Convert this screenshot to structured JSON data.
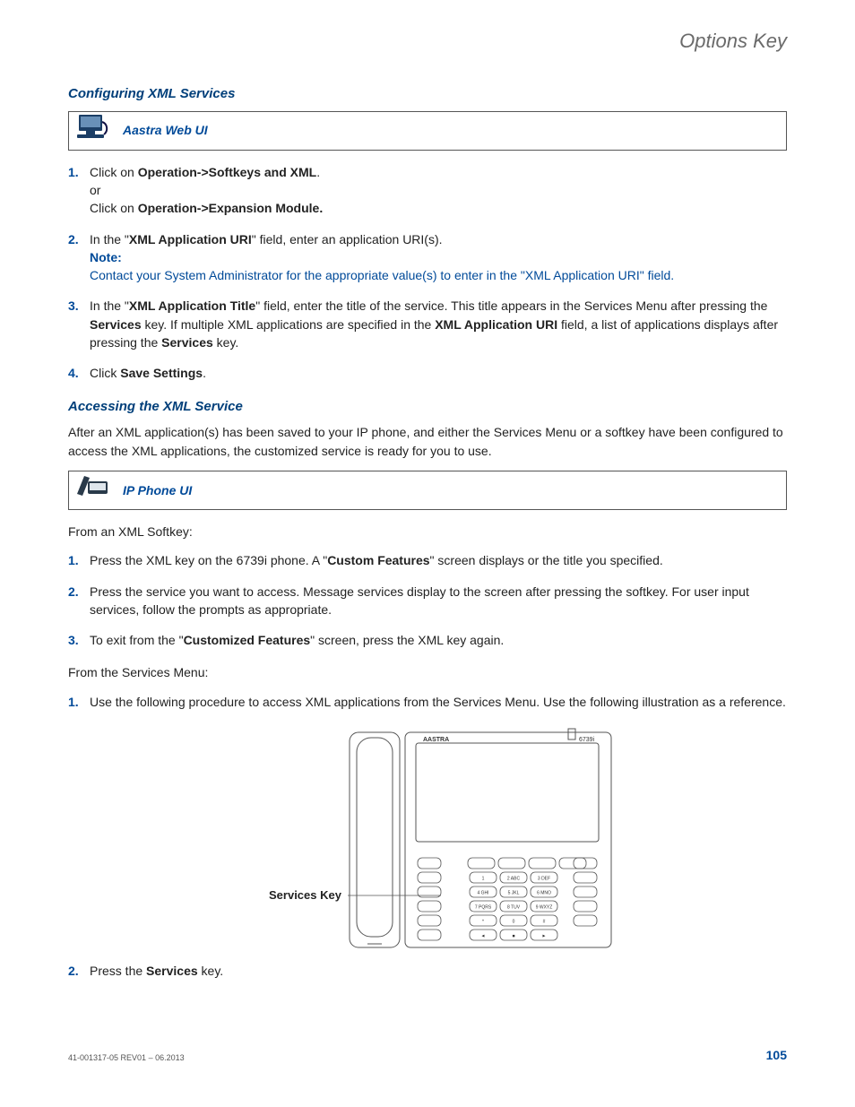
{
  "header": {
    "running_title": "Options Key"
  },
  "sec1": {
    "heading": "Configuring XML Services",
    "callout_title": "Aastra Web UI",
    "steps": [
      {
        "n": "1.",
        "a": "Click on ",
        "b": "Operation->Softkeys and XML",
        "c": ".",
        "d": "or",
        "e": "Click on ",
        "f": "Operation->Expansion Module."
      },
      {
        "n": "2.",
        "a": "In the \"",
        "b": "XML Application URI",
        "c": "\" field, enter an application URI(s).",
        "note_label": "Note:",
        "note_body": "Contact your System Administrator for the appropriate value(s) to enter in the \"XML Application URI\" field."
      },
      {
        "n": "3.",
        "a": "In the \"",
        "b": "XML Application Title",
        "c": "\" field, enter the title of the service. This title appears in the Services Menu after pressing the ",
        "d": "Services",
        "e": " key. If multiple XML applications are specified in the ",
        "f": "XML Application URI",
        "g": " field, a list of applications displays after pressing the ",
        "h": "Services",
        "i": " key."
      },
      {
        "n": "4.",
        "a": "Click ",
        "b": "Save Settings",
        "c": "."
      }
    ]
  },
  "sec2": {
    "heading": "Accessing the XML Service",
    "intro": "After an XML application(s) has been saved to your IP phone, and either the Services Menu or a softkey have been configured to access the XML applications, the customized service is ready for you to use.",
    "callout_title": "IP Phone UI",
    "lead1": "From an XML Softkey:",
    "stepsA": [
      {
        "n": "1.",
        "a": "Press the XML key on the 6739i phone. A \"",
        "b": "Custom Features",
        "c": "\" screen displays or the title you specified."
      },
      {
        "n": "2.",
        "a": "Press the service you want to access. Message services display to the screen after pressing the softkey. For user input services, follow the prompts as appropriate."
      },
      {
        "n": "3.",
        "a": "To exit from the \"",
        "b": "Customized Features",
        "c": "\" screen, press the XML key again."
      }
    ],
    "lead2": "From the Services Menu:",
    "stepsB": [
      {
        "n": "1.",
        "a": "Use the following procedure to access XML applications from the Services Menu. Use the following illustration as a reference."
      },
      {
        "n": "2.",
        "a": "Press the ",
        "b": "Services",
        "c": " key."
      }
    ]
  },
  "illustration": {
    "callout_label": "Services Key",
    "brand": "AASTRA",
    "model": "6739i",
    "keypad": {
      "r1": [
        "1",
        "2 ABC",
        "3 DEF"
      ],
      "r2": [
        "4 GHI",
        "5 JKL",
        "6 MNO"
      ],
      "r3": [
        "7 PQRS",
        "8 TUV",
        "9 WXYZ"
      ],
      "r4": [
        "*",
        "0",
        "#"
      ],
      "nav": [
        "◄",
        "■",
        "►"
      ]
    }
  },
  "footer": {
    "docid": "41-001317-05 REV01 – 06.2013",
    "page": "105"
  }
}
